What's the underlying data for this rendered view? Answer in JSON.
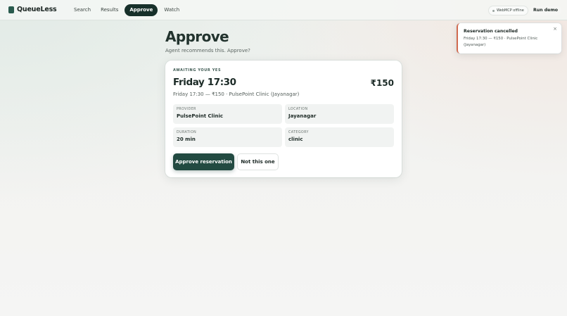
{
  "brand": {
    "name": "QueueLess",
    "icon": "logo-mark-icon"
  },
  "nav": {
    "items": [
      {
        "label": "Search",
        "active": false
      },
      {
        "label": "Results",
        "active": false
      },
      {
        "label": "Approve",
        "active": true
      },
      {
        "label": "Watch",
        "active": false
      }
    ]
  },
  "header": {
    "status_label": "WebMCP offline",
    "run_demo_label": "Run demo"
  },
  "page": {
    "title": "Approve",
    "subtitle": "Agent recommends this. Approve?"
  },
  "card": {
    "eyebrow": "AWAITING YOUR YES",
    "slot_title": "Friday 17:30",
    "price": "₹150",
    "slot_line": "Friday 17:30 — ₹150 · PulsePoint Clinic (Jayanagar)",
    "fields": [
      {
        "label": "PROVIDER",
        "value": "PulsePoint Clinic"
      },
      {
        "label": "LOCATION",
        "value": "Jayanagar"
      },
      {
        "label": "DURATION",
        "value": "20 min"
      },
      {
        "label": "CATEGORY",
        "value": "clinic"
      }
    ],
    "approve_label": "Approve reservation",
    "reject_label": "Not this one"
  },
  "toast": {
    "title": "Reservation cancelled",
    "body": "Friday 17:30 — ₹150 · PulsePoint Clinic (Jayanagar)",
    "close_icon": "close-icon",
    "accent_color": "#d26a4f"
  },
  "colors": {
    "primary": "#224a41",
    "nav_active_bg": "#17302a"
  }
}
